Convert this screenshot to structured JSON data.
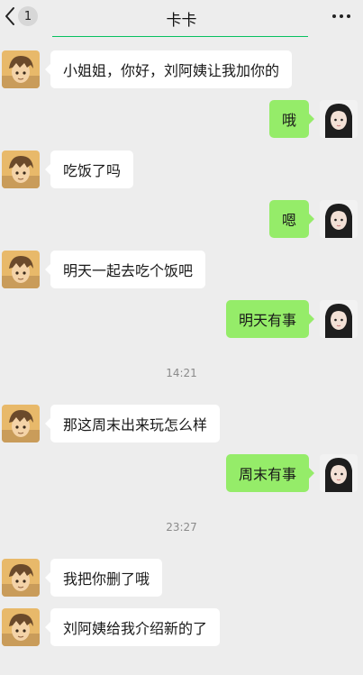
{
  "header": {
    "title": "卡卡",
    "unread_count": "1"
  },
  "colors": {
    "background": "#ededed",
    "incoming_bubble": "#ffffff",
    "outgoing_bubble": "#95ec69",
    "accent": "#07c160"
  },
  "messages": [
    {
      "side": "left",
      "text": "小姐姐，你好，刘阿姨让我加你的"
    },
    {
      "side": "right",
      "text": "哦"
    },
    {
      "side": "left",
      "text": "吃饭了吗"
    },
    {
      "side": "right",
      "text": "嗯"
    },
    {
      "side": "left",
      "text": "明天一起去吃个饭吧"
    },
    {
      "side": "right",
      "text": "明天有事"
    },
    {
      "side": "time",
      "text": "14:21"
    },
    {
      "side": "left",
      "text": "那这周末出来玩怎么样"
    },
    {
      "side": "right",
      "text": "周末有事"
    },
    {
      "side": "time",
      "text": "23:27"
    },
    {
      "side": "left",
      "text": "我把你删了哦"
    },
    {
      "side": "left",
      "text": "刘阿姨给我介绍新的了"
    }
  ]
}
